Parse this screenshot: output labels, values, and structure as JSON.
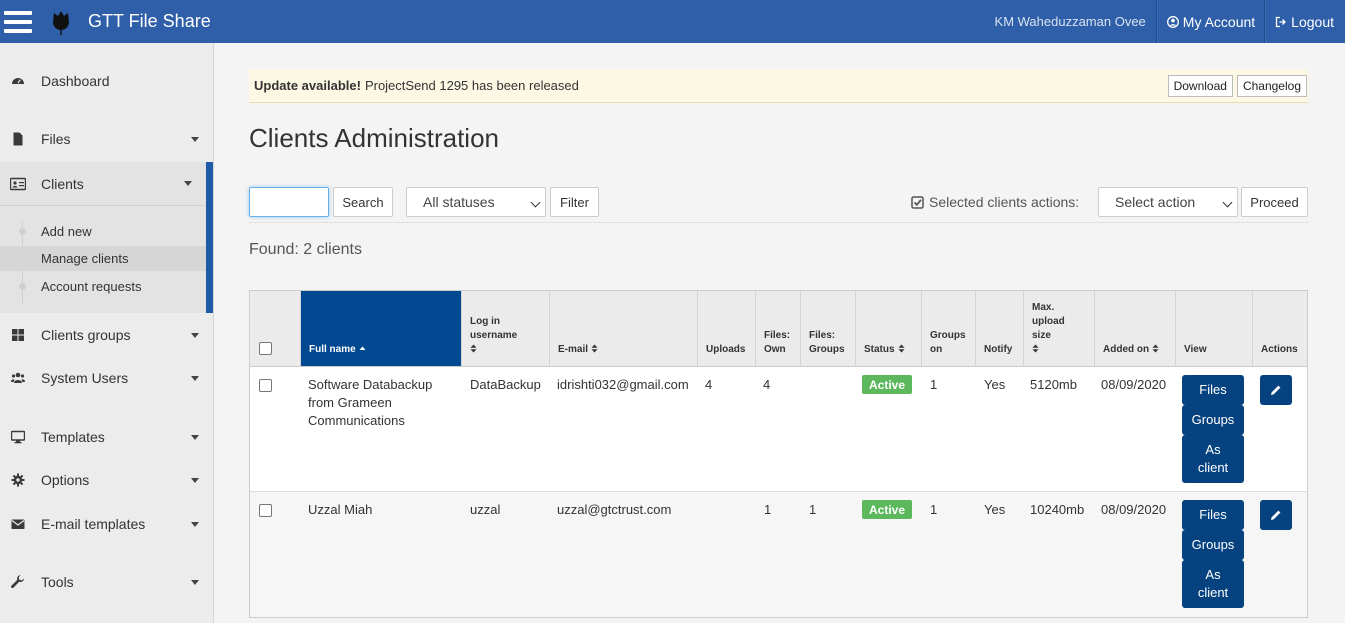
{
  "app": {
    "title": "GTT File Share"
  },
  "header": {
    "user_name": "KM Waheduzzaman Ovee",
    "my_account": "My Account",
    "logout": "Logout"
  },
  "sidebar": {
    "dashboard": "Dashboard",
    "files": "Files",
    "clients": "Clients",
    "clients_sub": [
      "Add new",
      "Manage clients",
      "Account requests"
    ],
    "clients_groups": "Clients groups",
    "system_users": "System Users",
    "templates": "Templates",
    "options": "Options",
    "email_templates": "E-mail templates",
    "tools": "Tools"
  },
  "alert": {
    "strong": "Update available!",
    "text": "ProjectSend 1295 has been released",
    "download": "Download",
    "changelog": "Changelog"
  },
  "page": {
    "title": "Clients Administration"
  },
  "toolbar": {
    "search_value": "",
    "search_button": "Search",
    "status_select": "All statuses",
    "filter_button": "Filter",
    "selected_actions_label": "Selected clients actions:",
    "action_select": "Select action",
    "proceed_button": "Proceed"
  },
  "found": "Found: 2 clients",
  "table": {
    "headers": {
      "full_name": "Full name",
      "username_1": "Log in",
      "username_2": "username",
      "email": "E-mail",
      "uploads": "Uploads",
      "files_own_1": "Files:",
      "files_own_2": "Own",
      "files_groups_1": "Files:",
      "files_groups_2": "Groups",
      "status": "Status",
      "groups_on_1": "Groups",
      "groups_on_2": "on",
      "notify": "Notify",
      "max_1": "Max.",
      "max_2": "upload",
      "max_3": "size",
      "added_on": "Added on",
      "view": "View",
      "actions": "Actions"
    },
    "view_buttons": {
      "files": "Files",
      "groups": "Groups",
      "as_client_1": "As",
      "as_client_2": "client"
    },
    "rows": [
      {
        "name_1": "Software Databackup",
        "name_2": "from Grameen",
        "name_3": "Communications",
        "username": "DataBackup",
        "email": "idrishti032@gmail.com",
        "uploads": "4",
        "files_own": "4",
        "files_groups": "",
        "status": "Active",
        "groups_on": "1",
        "notify": "Yes",
        "max_upload": "5120mb",
        "added_on": "08/09/2020"
      },
      {
        "name_1": "Uzzal Miah",
        "name_2": "",
        "name_3": "",
        "username": "uzzal",
        "email": "uzzal@gtctrust.com",
        "uploads": "",
        "files_own": "1",
        "files_groups": "1",
        "status": "Active",
        "groups_on": "1",
        "notify": "Yes",
        "max_upload": "10240mb",
        "added_on": "08/09/2020"
      }
    ]
  }
}
